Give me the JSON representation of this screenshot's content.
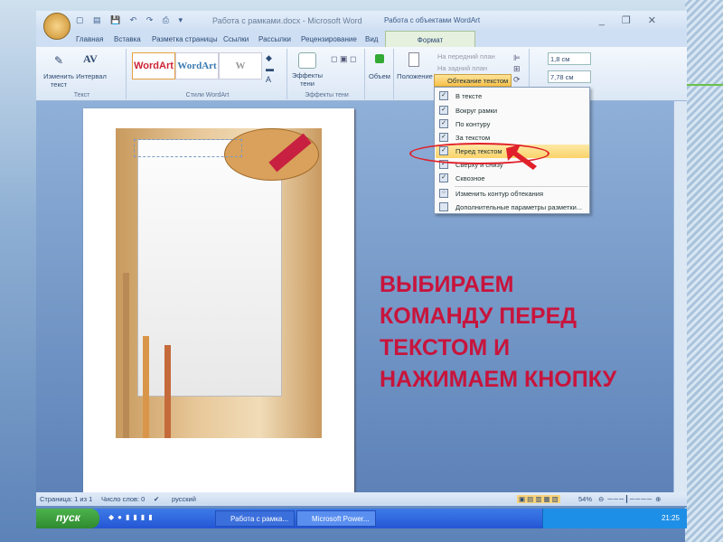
{
  "titlebar": {
    "title": "Работа с рамками.docx - Microsoft Word",
    "context_title": "Работа с объектами WordArt",
    "controls": "_ ❐ ✕"
  },
  "tabs": [
    "Главная",
    "Вставка",
    "Разметка страницы",
    "Ссылки",
    "Рассылки",
    "Рецензирование",
    "Вид"
  ],
  "active_tab": "Формат",
  "ribbon": {
    "text_group": {
      "label": "Текст",
      "edit_text": "Изменить текст",
      "spacing": "Интервал"
    },
    "wordart_styles": {
      "label": "Стили WordArt",
      "samples": [
        "WordArt",
        "WordArt",
        "W"
      ]
    },
    "shadow": {
      "label": "Эффекты тени",
      "button": "Эффекты тени"
    },
    "volume": {
      "button": "Объем"
    },
    "arrange": {
      "position": "Положение",
      "bring_forward": "На передний план",
      "send_backward": "На задний план",
      "text_wrap": "Обтекание текстом"
    },
    "size": {
      "height": "1,8 см",
      "width": "7,78 см"
    }
  },
  "wrap_menu": {
    "items": [
      "В тексте",
      "Вокруг рамки",
      "По контуру",
      "За текстом",
      "Перед текстом",
      "Сверху и снизу",
      "Сквозное",
      "Изменить контур обтекания",
      "Дополнительные параметры разметки..."
    ],
    "highlighted": "Перед текстом"
  },
  "instruction": [
    "ВЫБИРАЕМ",
    "КОМАНДУ ПЕРЕД",
    "ТЕКСТОМ И",
    "НАЖИМАЕМ КНОПКУ"
  ],
  "statusbar": {
    "page": "Страница: 1 из 1",
    "words": "Число слов: 0",
    "language": "русский",
    "zoom": "54%"
  },
  "taskbar": {
    "start": "пуск",
    "tasks": [
      "Работа с рамка...",
      "Microsoft Power..."
    ],
    "clock": "21:25"
  },
  "colors": {
    "instruction": "#c8143c",
    "highlight": "#fbd36a"
  }
}
